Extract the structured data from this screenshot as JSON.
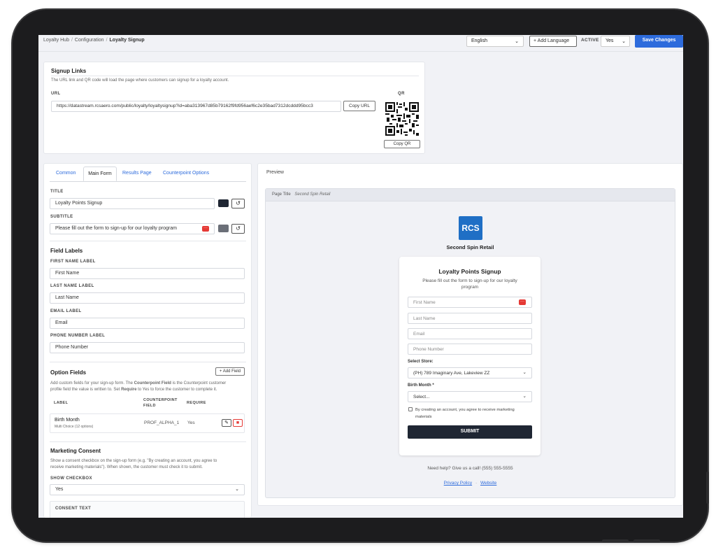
{
  "breadcrumb": {
    "items": [
      "Loyalty Hub",
      "Configuration",
      "Loyalty Signup"
    ]
  },
  "topbar": {
    "language": "English",
    "add_language": "+ Add Language",
    "active_label": "ACTIVE",
    "active_value": "Yes",
    "save": "Save Changes"
  },
  "signup_links": {
    "title": "Signup Links",
    "description": "The URL link and QR code will load the page where customers can signup for a loyalty account.",
    "url_label": "URL",
    "url_value": "https://datastream.rcsaero.com/public/loyalty/loyaltysignup?id=aba313967d85b79162f9fd956aef6c2e35bad7312dcddd95bcc3",
    "copy_url": "Copy URL",
    "qr_label": "QR",
    "copy_qr": "Copy QR"
  },
  "editor": {
    "tabs": [
      "Common",
      "Main Form",
      "Results Page",
      "Counterpoint Options"
    ],
    "title_label": "TITLE",
    "title_value": "Loyalty Points Signup",
    "subtitle_label": "SUBTITLE",
    "subtitle_value": "Please fill out the form to sign-up for our loyalty program",
    "field_labels_heading": "Field Labels",
    "first_name_label": "FIRST NAME LABEL",
    "first_name_value": "First Name",
    "last_name_label": "LAST NAME LABEL",
    "last_name_value": "Last Name",
    "email_label": "EMAIL LABEL",
    "email_value": "Email",
    "phone_label": "PHONE NUMBER LABEL",
    "phone_value": "Phone Number",
    "option_fields_heading": "Option Fields",
    "add_field": "+ Add Field",
    "option_desc_1": "Add custom fields for your sign-up form. The ",
    "option_desc_bold1": "Counterpoint Field",
    "option_desc_2": " is the Counterpoint customer",
    "option_desc_3": "profile field the value is written to. Set ",
    "option_desc_bold2": "Require",
    "option_desc_4": " to Yes to force the customer to complete it.",
    "col_label": "LABEL",
    "col_field_1": "COUNTERPOINT",
    "col_field_2": "FIELD",
    "col_require": "REQUIRE",
    "row_label": "Birth Month",
    "row_sub": "Multi Choice (12 options)",
    "row_field": "PROF_ALPHA_1",
    "row_require": "Yes",
    "marketing_heading": "Marketing Consent",
    "marketing_desc_1": "Show a consent checkbox on the sign-up form (e.g. \"By creating an account, you agree to",
    "marketing_desc_2": "receive marketing materials\"). When shown, the customer must check it to submit.",
    "show_checkbox_label": "SHOW CHECKBOX",
    "show_checkbox_value": "Yes",
    "consent_text_label": "CONSENT TEXT"
  },
  "preview": {
    "label": "Preview",
    "page_title_label": "Page Title",
    "page_title_value": "Second Spin Retail",
    "logo_text": "RCS",
    "store_name": "Second Spin Retail",
    "form_title": "Loyalty Points Signup",
    "form_subtitle_1": "Please fill out the form to sign-up for our loyalty",
    "form_subtitle_2": "program",
    "first_name": "First Name",
    "last_name": "Last Name",
    "email": "Email",
    "phone": "Phone Number",
    "select_store_label": "Select Store:",
    "store_value": "(PH) 789 Imaginary Ave, Lakeview ZZ",
    "birth_month_label": "Birth Month *",
    "birth_month_value": "Select...",
    "consent_1": "By creating an account, you agree to receive marketing",
    "consent_2": "materials",
    "submit": "SUBMIT",
    "help": "Need help? Give us a call! (555) 555-5555",
    "privacy": "Privacy Policy",
    "dot": "·",
    "website": "Website"
  },
  "colors": {
    "accent": "#2d6bdc",
    "title_swatch": "#1f2633",
    "subtitle_swatch": "#6b6f78",
    "submit_bg": "#1f2633",
    "logo_bg": "#1f6fc5"
  }
}
